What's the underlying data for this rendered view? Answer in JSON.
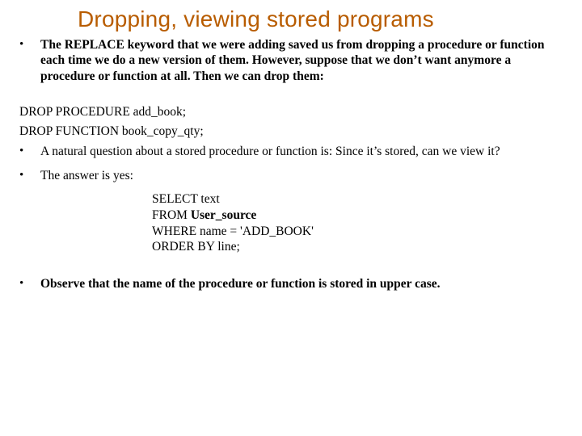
{
  "title": "Dropping, viewing stored programs",
  "bullets1": [
    "The REPLACE keyword that we were adding saved us from dropping a procedure or function each time we do a new version of them. However, suppose that we don’t want anymore a procedure or function at all. Then we can drop them:"
  ],
  "stmt1": "DROP PROCEDURE add_book;",
  "stmt2": "DROP FUNCTION book_copy_qty;",
  "bullets2": [
    "A natural question about a stored procedure or function is: Since it’s stored, can we view it?",
    "The answer is yes:"
  ],
  "code": {
    "l1": "SELECT text",
    "l2_a": "FROM ",
    "l2_b": "User_source",
    "l3": "WHERE name = 'ADD_BOOK'",
    "l4": "ORDER BY line;"
  },
  "bullets3": [
    "Observe that the name of the procedure or function is stored in upper case."
  ]
}
